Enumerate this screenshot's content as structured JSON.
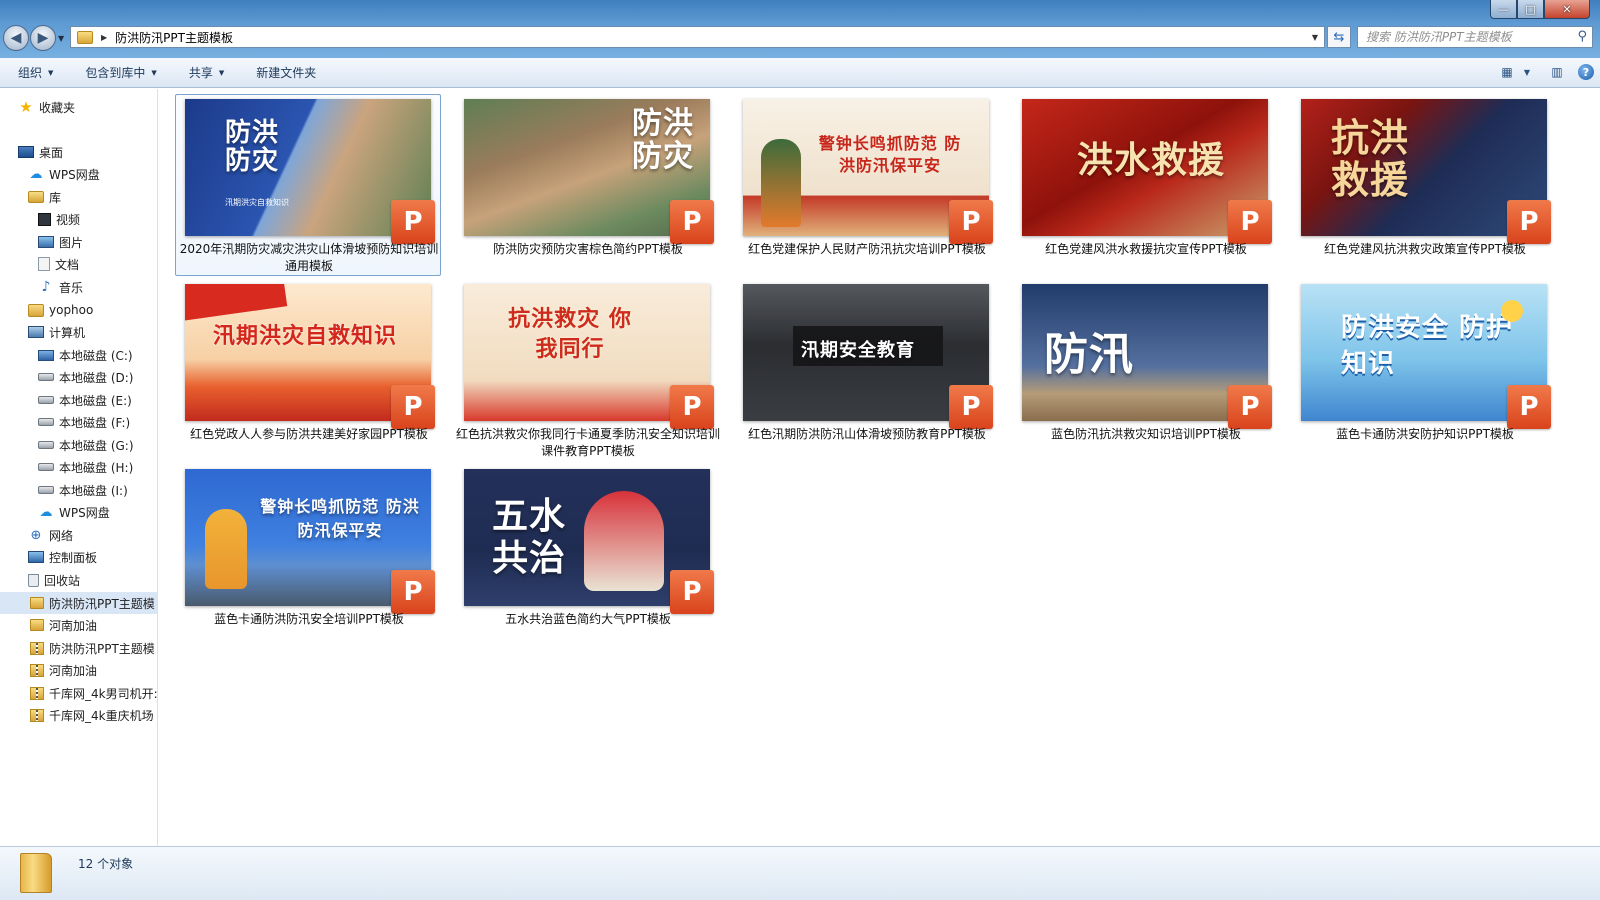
{
  "window": {
    "address": {
      "crumb": "防洪防汛PPT主题模板"
    },
    "search": {
      "placeholder": "搜索 防洪防汛PPT主题模板"
    },
    "controls": {
      "minimize": "—",
      "maximize": "□",
      "close": "✕"
    }
  },
  "toolbar": {
    "organize": "组织",
    "include_in_library": "包含到库中",
    "share": "共享",
    "new_folder": "新建文件夹"
  },
  "sidebar": {
    "items": [
      {
        "label": "收藏夹",
        "icon": "star-icon"
      },
      {
        "label": "桌面",
        "icon": "desktop-icon"
      },
      {
        "label": "WPS网盘",
        "icon": "cloud-icon"
      },
      {
        "label": "库",
        "icon": "library-icon"
      },
      {
        "label": "视频",
        "icon": "video-icon"
      },
      {
        "label": "图片",
        "icon": "picture-icon"
      },
      {
        "label": "文档",
        "icon": "document-icon"
      },
      {
        "label": "音乐",
        "icon": "music-icon"
      },
      {
        "label": "yophoo",
        "icon": "user-folder-icon"
      },
      {
        "label": "计算机",
        "icon": "computer-icon"
      },
      {
        "label": "本地磁盘 (C:)",
        "icon": "system-disk-icon"
      },
      {
        "label": "本地磁盘 (D:)",
        "icon": "disk-icon"
      },
      {
        "label": "本地磁盘 (E:)",
        "icon": "disk-icon"
      },
      {
        "label": "本地磁盘 (F:)",
        "icon": "disk-icon"
      },
      {
        "label": "本地磁盘 (G:)",
        "icon": "disk-icon"
      },
      {
        "label": "本地磁盘 (H:)",
        "icon": "disk-icon"
      },
      {
        "label": "本地磁盘 (I:)",
        "icon": "disk-icon"
      },
      {
        "label": "WPS网盘",
        "icon": "cloud-icon"
      },
      {
        "label": "网络",
        "icon": "network-icon"
      },
      {
        "label": "控制面板",
        "icon": "control-panel-icon"
      },
      {
        "label": "回收站",
        "icon": "recycle-bin-icon"
      },
      {
        "label": "防洪防汛PPT主题模",
        "icon": "folder-icon"
      },
      {
        "label": "河南加油",
        "icon": "folder-icon"
      },
      {
        "label": "防洪防汛PPT主题模",
        "icon": "zip-icon"
      },
      {
        "label": "河南加油",
        "icon": "zip-icon"
      },
      {
        "label": "千库网_4k男司机开:",
        "icon": "zip-icon"
      },
      {
        "label": "千库网_4k重庆机场",
        "icon": "zip-icon"
      }
    ]
  },
  "files": [
    {
      "name": "2020年汛期防灾减灾洪灾山体滑坡预防知识培训通用模板",
      "thumb_title": "防洪防灾",
      "thumb_sub": "汛期洪灾自救知识",
      "colors": [
        "#1f3f8f",
        "#4d7fc4"
      ]
    },
    {
      "name": "防洪防灾预防灾害棕色简约PPT模板",
      "thumb_title": "防洪防灾",
      "thumb_sub": "",
      "colors": [
        "#8c6a4a",
        "#c9a47c"
      ]
    },
    {
      "name": "红色党建保护人民财产防汛抗灾培训PPT模板",
      "thumb_title": "警钟长鸣抓防范 防洪防汛保平安",
      "thumb_sub": "",
      "colors": [
        "#f7efe4",
        "#e0c7a7"
      ]
    },
    {
      "name": "红色党建风洪水救援抗灾宣传PPT模板",
      "thumb_title": "洪水救援",
      "thumb_sub": "",
      "colors": [
        "#a8170f",
        "#d9301f"
      ]
    },
    {
      "name": "红色党建风抗洪救灾政策宣传PPT模板",
      "thumb_title": "抗洪救援",
      "thumb_sub": "",
      "colors": [
        "#1b2c5c",
        "#b01c16"
      ]
    },
    {
      "name": "红色党政人人参与防洪共建美好家园PPT模板",
      "thumb_title": "汛期洪灾自救知识",
      "thumb_sub": "",
      "colors": [
        "#fbe3c5",
        "#e2351f"
      ]
    },
    {
      "name": "红色抗洪救灾你我同行卡通夏季防汛安全知识培训课件教育PPT模板",
      "thumb_title": "抗洪救灾 你我同行",
      "thumb_sub": "",
      "colors": [
        "#f6e7d2",
        "#d63a2a"
      ]
    },
    {
      "name": "红色汛期防洪防汛山体滑坡预防教育PPT模板",
      "thumb_title": "汛期安全教育",
      "thumb_sub": "",
      "colors": [
        "#2d2f33",
        "#6a6d72"
      ]
    },
    {
      "name": "蓝色防汛抗洪救灾知识培训PPT模板",
      "thumb_title": "防汛",
      "thumb_sub": "",
      "colors": [
        "#213b6b",
        "#6a86b4"
      ]
    },
    {
      "name": "蓝色卡通防洪安防护知识PPT模板",
      "thumb_title": "防洪安全 防护知识",
      "thumb_sub": "",
      "colors": [
        "#7cc6ec",
        "#3f86cf"
      ]
    },
    {
      "name": "蓝色卡通防洪防汛安全培训PPT模板",
      "thumb_title": "警钟长鸣抓防范 防洪防汛保平安",
      "thumb_sub": "",
      "colors": [
        "#2f6fd6",
        "#7fb3ee"
      ]
    },
    {
      "name": "五水共治蓝色简约大气PPT模板",
      "thumb_title": "五水共治",
      "thumb_sub": "",
      "colors": [
        "#1f2d52",
        "#3a4f7e"
      ]
    }
  ],
  "status": {
    "count": "12 个对象"
  }
}
